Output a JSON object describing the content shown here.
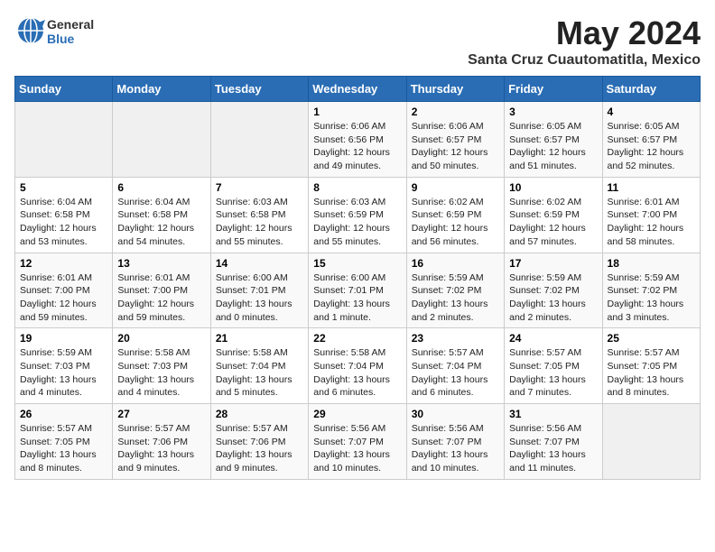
{
  "logo": {
    "text_general": "General",
    "text_blue": "Blue"
  },
  "title": "May 2024",
  "subtitle": "Santa Cruz Cuautomatitla, Mexico",
  "headers": [
    "Sunday",
    "Monday",
    "Tuesday",
    "Wednesday",
    "Thursday",
    "Friday",
    "Saturday"
  ],
  "weeks": [
    [
      {
        "day": "",
        "info": ""
      },
      {
        "day": "",
        "info": ""
      },
      {
        "day": "",
        "info": ""
      },
      {
        "day": "1",
        "info": "Sunrise: 6:06 AM\nSunset: 6:56 PM\nDaylight: 12 hours\nand 49 minutes."
      },
      {
        "day": "2",
        "info": "Sunrise: 6:06 AM\nSunset: 6:57 PM\nDaylight: 12 hours\nand 50 minutes."
      },
      {
        "day": "3",
        "info": "Sunrise: 6:05 AM\nSunset: 6:57 PM\nDaylight: 12 hours\nand 51 minutes."
      },
      {
        "day": "4",
        "info": "Sunrise: 6:05 AM\nSunset: 6:57 PM\nDaylight: 12 hours\nand 52 minutes."
      }
    ],
    [
      {
        "day": "5",
        "info": "Sunrise: 6:04 AM\nSunset: 6:58 PM\nDaylight: 12 hours\nand 53 minutes."
      },
      {
        "day": "6",
        "info": "Sunrise: 6:04 AM\nSunset: 6:58 PM\nDaylight: 12 hours\nand 54 minutes."
      },
      {
        "day": "7",
        "info": "Sunrise: 6:03 AM\nSunset: 6:58 PM\nDaylight: 12 hours\nand 55 minutes."
      },
      {
        "day": "8",
        "info": "Sunrise: 6:03 AM\nSunset: 6:59 PM\nDaylight: 12 hours\nand 55 minutes."
      },
      {
        "day": "9",
        "info": "Sunrise: 6:02 AM\nSunset: 6:59 PM\nDaylight: 12 hours\nand 56 minutes."
      },
      {
        "day": "10",
        "info": "Sunrise: 6:02 AM\nSunset: 6:59 PM\nDaylight: 12 hours\nand 57 minutes."
      },
      {
        "day": "11",
        "info": "Sunrise: 6:01 AM\nSunset: 7:00 PM\nDaylight: 12 hours\nand 58 minutes."
      }
    ],
    [
      {
        "day": "12",
        "info": "Sunrise: 6:01 AM\nSunset: 7:00 PM\nDaylight: 12 hours\nand 59 minutes."
      },
      {
        "day": "13",
        "info": "Sunrise: 6:01 AM\nSunset: 7:00 PM\nDaylight: 12 hours\nand 59 minutes."
      },
      {
        "day": "14",
        "info": "Sunrise: 6:00 AM\nSunset: 7:01 PM\nDaylight: 13 hours\nand 0 minutes."
      },
      {
        "day": "15",
        "info": "Sunrise: 6:00 AM\nSunset: 7:01 PM\nDaylight: 13 hours\nand 1 minute."
      },
      {
        "day": "16",
        "info": "Sunrise: 5:59 AM\nSunset: 7:02 PM\nDaylight: 13 hours\nand 2 minutes."
      },
      {
        "day": "17",
        "info": "Sunrise: 5:59 AM\nSunset: 7:02 PM\nDaylight: 13 hours\nand 2 minutes."
      },
      {
        "day": "18",
        "info": "Sunrise: 5:59 AM\nSunset: 7:02 PM\nDaylight: 13 hours\nand 3 minutes."
      }
    ],
    [
      {
        "day": "19",
        "info": "Sunrise: 5:59 AM\nSunset: 7:03 PM\nDaylight: 13 hours\nand 4 minutes."
      },
      {
        "day": "20",
        "info": "Sunrise: 5:58 AM\nSunset: 7:03 PM\nDaylight: 13 hours\nand 4 minutes."
      },
      {
        "day": "21",
        "info": "Sunrise: 5:58 AM\nSunset: 7:04 PM\nDaylight: 13 hours\nand 5 minutes."
      },
      {
        "day": "22",
        "info": "Sunrise: 5:58 AM\nSunset: 7:04 PM\nDaylight: 13 hours\nand 6 minutes."
      },
      {
        "day": "23",
        "info": "Sunrise: 5:57 AM\nSunset: 7:04 PM\nDaylight: 13 hours\nand 6 minutes."
      },
      {
        "day": "24",
        "info": "Sunrise: 5:57 AM\nSunset: 7:05 PM\nDaylight: 13 hours\nand 7 minutes."
      },
      {
        "day": "25",
        "info": "Sunrise: 5:57 AM\nSunset: 7:05 PM\nDaylight: 13 hours\nand 8 minutes."
      }
    ],
    [
      {
        "day": "26",
        "info": "Sunrise: 5:57 AM\nSunset: 7:05 PM\nDaylight: 13 hours\nand 8 minutes."
      },
      {
        "day": "27",
        "info": "Sunrise: 5:57 AM\nSunset: 7:06 PM\nDaylight: 13 hours\nand 9 minutes."
      },
      {
        "day": "28",
        "info": "Sunrise: 5:57 AM\nSunset: 7:06 PM\nDaylight: 13 hours\nand 9 minutes."
      },
      {
        "day": "29",
        "info": "Sunrise: 5:56 AM\nSunset: 7:07 PM\nDaylight: 13 hours\nand 10 minutes."
      },
      {
        "day": "30",
        "info": "Sunrise: 5:56 AM\nSunset: 7:07 PM\nDaylight: 13 hours\nand 10 minutes."
      },
      {
        "day": "31",
        "info": "Sunrise: 5:56 AM\nSunset: 7:07 PM\nDaylight: 13 hours\nand 11 minutes."
      },
      {
        "day": "",
        "info": ""
      }
    ]
  ]
}
